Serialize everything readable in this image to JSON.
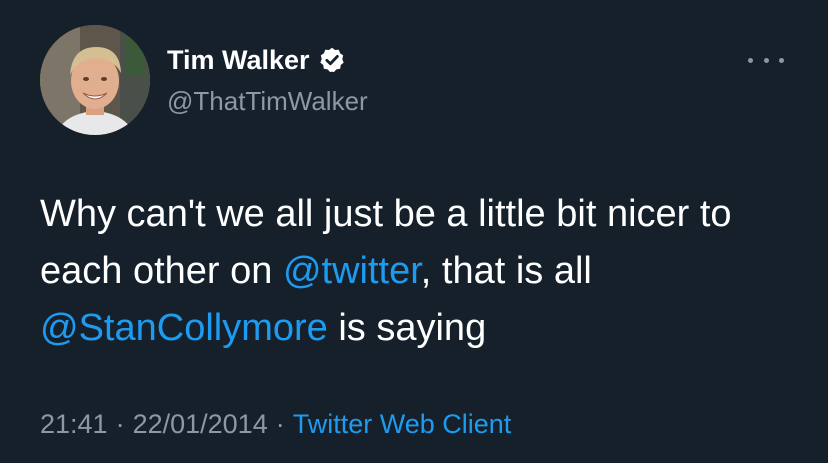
{
  "author": {
    "display_name": "Tim Walker",
    "handle": "@ThatTimWalker",
    "verified": true
  },
  "tweet": {
    "text_1": "Why can't we all just be a little bit nicer to each other on ",
    "mention_1": "@twitter",
    "text_2": ", that is all ",
    "mention_2": "@StanCollymore",
    "text_3": " is saying"
  },
  "meta": {
    "time": "21:41",
    "separator": "·",
    "date": "22/01/2014",
    "source": "Twitter Web Client"
  },
  "colors": {
    "background": "#15202b",
    "accent": "#1d9bf0",
    "secondary_text": "#8b98a5"
  },
  "icons": {
    "verified": "verified-badge-icon",
    "more": "more-options-icon"
  }
}
